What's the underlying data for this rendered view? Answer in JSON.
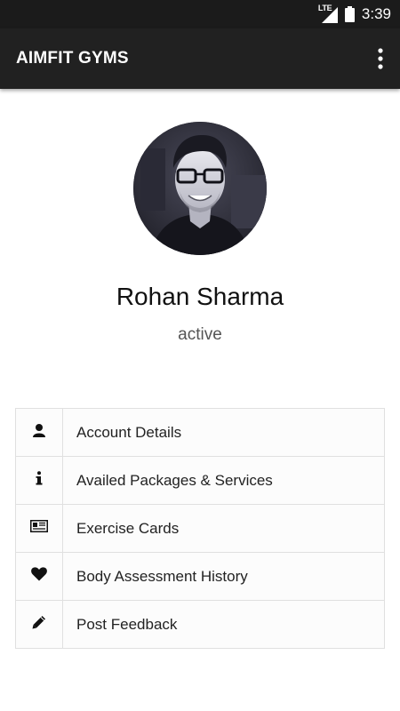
{
  "status_bar": {
    "network": "LTE",
    "time": "3:39",
    "icons": [
      "lte-signal-icon",
      "battery-icon"
    ]
  },
  "app_bar": {
    "title": "AIMFIT GYMS",
    "menu_icon": "more-vert-icon"
  },
  "profile": {
    "name": "Rohan Sharma",
    "status": "active"
  },
  "menu": {
    "items": [
      {
        "label": "Account Details",
        "icon": "user-icon"
      },
      {
        "label": "Availed Packages & Services",
        "icon": "info-icon"
      },
      {
        "label": "Exercise Cards",
        "icon": "id-card-icon"
      },
      {
        "label": "Body Assessment History",
        "icon": "heart-icon"
      },
      {
        "label": "Post Feedback",
        "icon": "pencil-icon"
      }
    ]
  },
  "colors": {
    "status_bar": "#1b1b1b",
    "app_bar": "#212121",
    "app_bar_text": "#ffffff",
    "list_border": "#e0e0e0",
    "list_background": "#fcfcfc"
  }
}
